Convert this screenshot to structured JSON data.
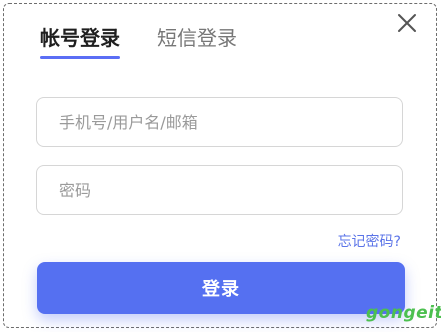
{
  "tabs": {
    "account_login": "帐号登录",
    "sms_login": "短信登录",
    "active": "account_login"
  },
  "form": {
    "account_placeholder": "手机号/用户名/邮箱",
    "account_value": "",
    "password_placeholder": "密码",
    "password_value": ""
  },
  "links": {
    "forgot_password": "忘记密码?"
  },
  "buttons": {
    "login": "登录"
  },
  "icons": {
    "close": "close-icon"
  },
  "colors": {
    "accent": "#5570f1",
    "link": "#5b74e8",
    "watermark": "#4cc04f"
  },
  "watermark": "gongeit"
}
